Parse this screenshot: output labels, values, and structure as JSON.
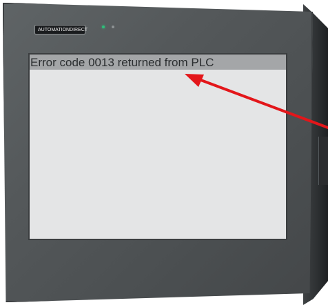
{
  "device": {
    "brand": "AUTOMATIONDIRECT",
    "logo_icon": "automationdirect-logo-icon",
    "leds": [
      {
        "name": "run-led",
        "color": "#2fbf7a"
      },
      {
        "name": "status-led",
        "color": "#8d9294"
      }
    ],
    "bezel_color": "#54585a"
  },
  "screen": {
    "message": "Error code 0013 returned from PLC",
    "message_bar_color": "#a4a6a8",
    "background_color": "#e4e5e6"
  },
  "annotation": {
    "icon": "red-arrow-icon",
    "color": "#e3161a"
  }
}
